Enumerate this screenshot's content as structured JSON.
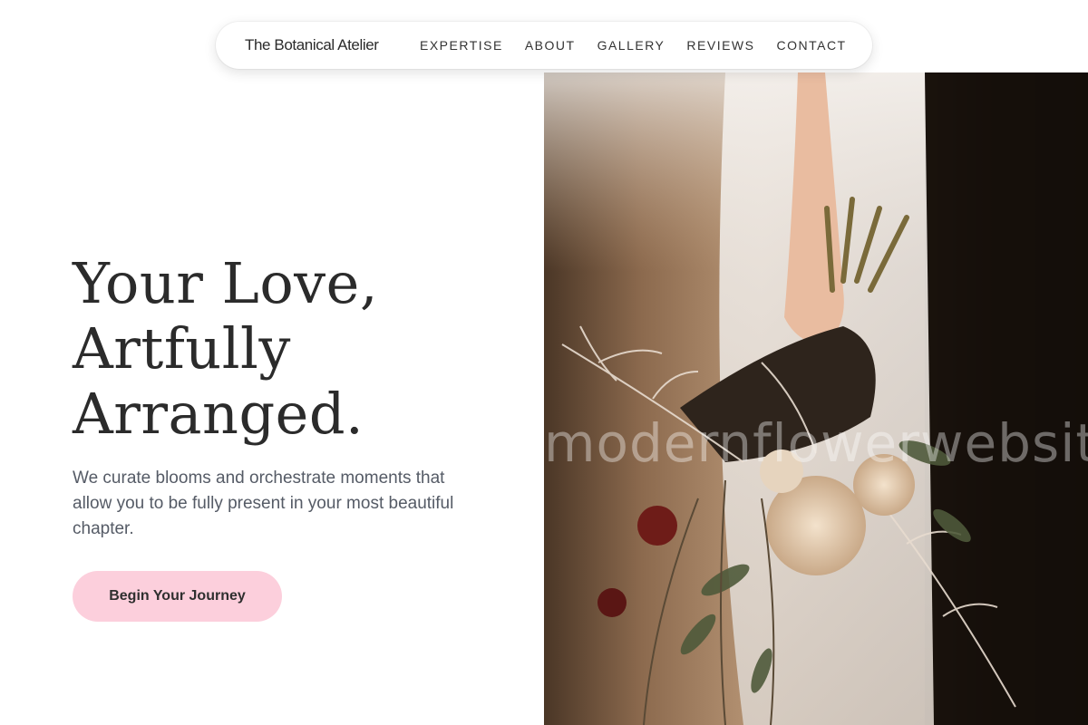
{
  "nav": {
    "brand": "The Botanical Atelier",
    "links": [
      "EXPERTISE",
      "ABOUT",
      "GALLERY",
      "REVIEWS",
      "CONTACT"
    ]
  },
  "hero": {
    "title_lines": [
      "Your Love,",
      "Artfully",
      "Arranged."
    ],
    "subtitle": "We curate blooms and orchestrate moments that allow you to be fully present in your most beautiful chapter.",
    "cta_label": "Begin Your Journey",
    "watermark": "modernflowerwebsite"
  },
  "colors": {
    "cta_background": "#fccfdc",
    "text_dark": "#2b2b2b",
    "text_muted": "#555b66"
  }
}
